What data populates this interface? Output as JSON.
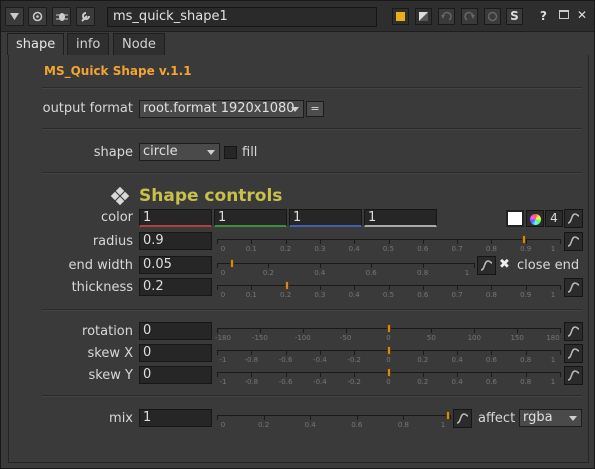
{
  "titlebar": {
    "node_name": "ms_quick_shape1",
    "icons": [
      "collapse-triangle-icon",
      "node-center-icon",
      "bug-icon",
      "wrench-icon",
      "yellow-swatch",
      "checker-swatch",
      "undo-icon",
      "redo-icon",
      "revert-icon",
      "S",
      "?",
      "float-icon",
      "close-icon"
    ],
    "help_label": "?",
    "s_label": "S",
    "close_label": "✕"
  },
  "tabs": [
    "shape",
    "info",
    "Node"
  ],
  "header": {
    "title": "MS_Quick Shape v.1.1"
  },
  "output_format": {
    "label": "output format",
    "value": "root.format 1920x1080",
    "eq": "="
  },
  "shape": {
    "label": "shape",
    "value": "circle",
    "fill_label": "fill"
  },
  "section": {
    "title": "Shape controls"
  },
  "color": {
    "label": "color",
    "r": "1",
    "g": "1",
    "b": "1",
    "a": "1",
    "channels": "4"
  },
  "radius": {
    "label": "radius",
    "value": "0.9",
    "ticks": [
      "0",
      "0.1",
      "0.2",
      "0.3",
      "0.4",
      "0.5",
      "0.6",
      "0.7",
      "0.8",
      "0.9",
      "1"
    ]
  },
  "end_width": {
    "label": "end width",
    "value": "0.05",
    "close_end_label": "close end",
    "ticks": [
      "0",
      "0.2",
      "0.4",
      "0.6",
      "0.8",
      "1"
    ]
  },
  "thickness": {
    "label": "thickness",
    "value": "0.2",
    "ticks": [
      "0",
      "0.1",
      "0.2",
      "0.3",
      "0.4",
      "0.5",
      "0.6",
      "0.7",
      "0.8",
      "0.9",
      "1"
    ]
  },
  "rotation": {
    "label": "rotation",
    "value": "0",
    "ticks": [
      "-180",
      "-150",
      "-100",
      "-50",
      "0",
      "50",
      "100",
      "150",
      "180"
    ]
  },
  "skew_x": {
    "label": "skew X",
    "value": "0",
    "ticks": [
      "-1",
      "-0.8",
      "-0.6",
      "-0.4",
      "-0.2",
      "0",
      "0.2",
      "0.4",
      "0.6",
      "0.8",
      "1"
    ]
  },
  "skew_y": {
    "label": "skew Y",
    "value": "0",
    "ticks": [
      "-1",
      "-0.8",
      "-0.6",
      "-0.4",
      "-0.2",
      "0",
      "0.2",
      "0.4",
      "0.6",
      "0.8",
      "1"
    ]
  },
  "mix": {
    "label": "mix",
    "value": "1",
    "affect_label": "affect",
    "affect_value": "rgba",
    "ticks": [
      "0",
      "0.2",
      "0.4",
      "0.6",
      "0.8",
      "1"
    ]
  },
  "colors": {
    "accent": "#f2a531",
    "section": "#c8c04a",
    "handle": "#c98a2a"
  }
}
